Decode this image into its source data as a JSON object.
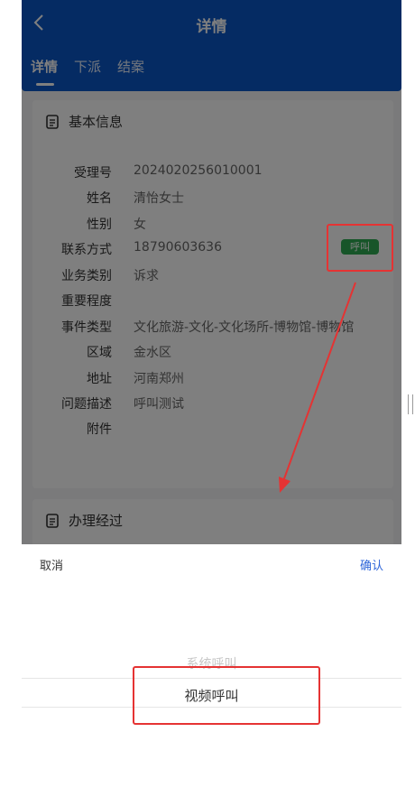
{
  "header": {
    "title": "详情",
    "tabs": [
      {
        "label": "详情"
      },
      {
        "label": "下派"
      },
      {
        "label": "结案"
      }
    ]
  },
  "basic_info": {
    "section_title": "基本信息",
    "fields": [
      {
        "label": "受理号",
        "value": "2024020256010001"
      },
      {
        "label": "姓名",
        "value": "清怡女士"
      },
      {
        "label": "性别",
        "value": "女"
      },
      {
        "label": "联系方式",
        "value": "18790603636"
      },
      {
        "label": "业务类别",
        "value": "诉求"
      },
      {
        "label": "重要程度",
        "value": ""
      },
      {
        "label": "事件类型",
        "value": "文化旅游-文化-文化场所-博物馆-博物馆"
      },
      {
        "label": "区域",
        "value": "金水区"
      },
      {
        "label": "地址",
        "value": "河南郑州"
      },
      {
        "label": "问题描述",
        "value": "呼叫测试"
      },
      {
        "label": "附件",
        "value": ""
      }
    ],
    "call_button": "呼叫"
  },
  "process": {
    "section_title": "办理经过"
  },
  "picker": {
    "cancel": "取消",
    "confirm": "确认",
    "options": [
      "系统呼叫",
      "视频呼叫"
    ],
    "selected": "视频呼叫"
  },
  "colors": {
    "header": "#0a56c6",
    "call_badge": "#2eaa52",
    "confirm": "#2f66d9",
    "annotation": "#e53333"
  }
}
